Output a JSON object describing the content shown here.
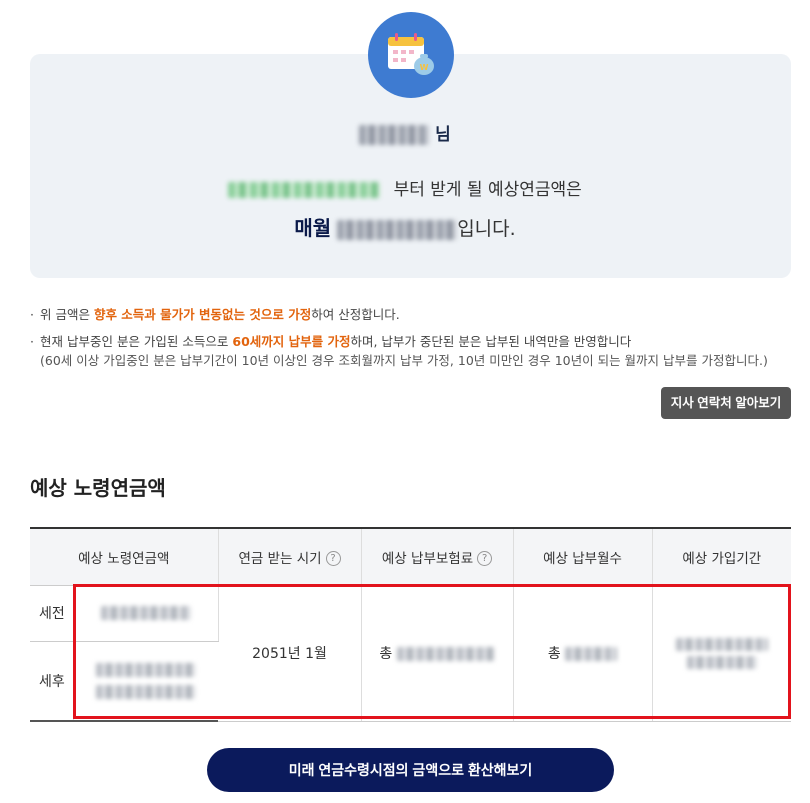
{
  "summary": {
    "name_suffix": "님",
    "from_text": "부터 받게 될 예상연금액은",
    "monthly_label": "매월",
    "monthly_suffix": "입니다."
  },
  "notes": {
    "n1_pre": "위 금액은 ",
    "n1_em": "향후 소득과 물가가 변동없는 것으로 가정",
    "n1_post": "하여 산정합니다.",
    "n2_pre": "현재 납부중인 분은 가입된 소득으로 ",
    "n2_em": "60세까지 납부를 가정",
    "n2_post": "하며, 납부가 중단된 분은 납부된 내역만을 반영합니다",
    "n2_sub": "(60세 이상 가입중인 분은 납부기간이 10년 이상인 경우 조회월까지 납부 가정, 10년 미만인 경우 10년이 되는 월까지 납부를 가정합니다.)"
  },
  "contact_button": "지사 연락처 알아보기",
  "section_title": "예상 노령연금액",
  "table": {
    "headers": [
      "예상 노령연금액",
      "연금 받는 시기",
      "예상 납부보험료",
      "예상 납부월수",
      "예상 가입기간"
    ],
    "row_labels": [
      "세전",
      "세후"
    ],
    "start_time": "2051년 1월",
    "premium_prefix": "총",
    "months_prefix": "총"
  },
  "convert_button": "미래 연금수령시점의 금액으로 환산해보기",
  "colors": {
    "accent_orange": "#e2640e",
    "navy": "#0b1a5c",
    "badge_blue": "#3e7bd1",
    "highlight_red": "#e2131c"
  }
}
